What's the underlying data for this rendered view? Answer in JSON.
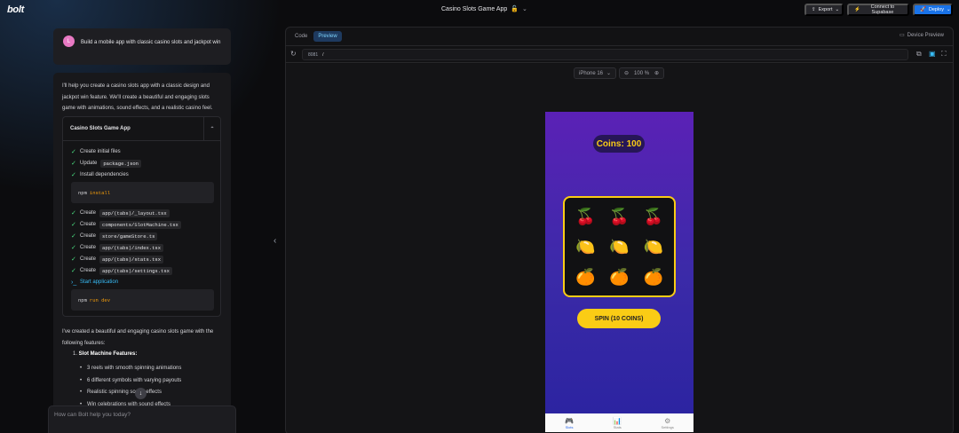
{
  "app": {
    "logo": "bolt",
    "title": "Casino Slots Game App"
  },
  "header": {
    "export_label": "Export",
    "supabase_label": "Connect to Supabase",
    "deploy_label": "Deploy"
  },
  "chat": {
    "user_avatar": "L",
    "user_message": "Build a mobile app with classic casino slots and jackpot win",
    "intro": "I'll help you create a casino slots app with a classic design and jackpot win feature. We'll create a beautiful and engaging slots game with animations, sound effects, and a realistic casino feel.",
    "artifact_title": "Casino Slots Game App",
    "steps": [
      {
        "text": "Create initial files",
        "code": ""
      },
      {
        "text": "Update",
        "code": "package.json"
      },
      {
        "text": "Install dependencies",
        "code": ""
      }
    ],
    "cmd1": {
      "cmd": "npm",
      "arg": "install"
    },
    "steps2": [
      {
        "text": "Create",
        "code": "app/(tabs)/_layout.tsx"
      },
      {
        "text": "Create",
        "code": "components/SlotMachine.tsx"
      },
      {
        "text": "Create",
        "code": "store/gameStore.ts"
      },
      {
        "text": "Create",
        "code": "app/(tabs)/index.tsx"
      },
      {
        "text": "Create",
        "code": "app/(tabs)/stats.tsx"
      },
      {
        "text": "Create",
        "code": "app/(tabs)/settings.tsx"
      }
    ],
    "start_label": "Start application",
    "cmd2": {
      "cmd": "npm",
      "arg": "run dev"
    },
    "summary": "I've created a beautiful and engaging casino slots game with the following features:",
    "feature_heading": "Slot Machine Features:",
    "features": [
      "3 reels with smooth spinning animations",
      "6 different symbols with varying payouts",
      "Realistic spinning sound effects",
      "Win celebrations with sound effects"
    ],
    "prompt_placeholder": "How can Bolt help you today?"
  },
  "preview": {
    "tabs": [
      "Code",
      "Preview"
    ],
    "device_preview_label": "Device Preview",
    "url_host": "8081",
    "url_path": "/",
    "device": "iPhone 16",
    "zoom": "100 %"
  },
  "game": {
    "coins_text": "Coins: 100",
    "reels": [
      "🍒",
      "🍒",
      "🍒",
      "🍋",
      "🍋",
      "🍋",
      "🍊",
      "🍊",
      "🍊"
    ],
    "spin_label": "SPIN (10 COINS)",
    "tabs": [
      {
        "label": "Slots",
        "icon": "🎮"
      },
      {
        "label": "Stats",
        "icon": "📊"
      },
      {
        "label": "Settings",
        "icon": "⚙"
      }
    ],
    "colors": {
      "accent": "#facc15",
      "bg_top": "#5b21b6",
      "bg_bottom": "#2a23a0"
    }
  }
}
